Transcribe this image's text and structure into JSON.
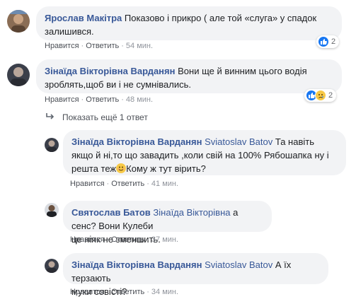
{
  "comments": [
    {
      "author": "Ярослав Макітра",
      "text": "Показово і прикро ( але той «слуга» у спадок залишився.",
      "like_label": "Нравится",
      "reply_label": "Ответить",
      "time": "54 мин.",
      "reactions_count": "2"
    },
    {
      "author": "Зінаїда Вікторівна Варданян",
      "text": "Вони ще й винним цього водія зроблять,щоб ви і не сумнівались.",
      "like_label": "Нравится",
      "reply_label": "Ответить",
      "time": "48 мин.",
      "reactions_count": "2"
    }
  ],
  "show_more_label": "Показать ещё 1 ответ",
  "replies": [
    {
      "author": "Зінаїда Вікторівна Варданян",
      "mention": "Sviatoslav Batov",
      "text_line1": "Та навіть",
      "text_line2": "якщо й ні,то що завадить ,коли свій на 100% Рябошапка ну і",
      "text_line3_a": "решта теж",
      "text_line3_b": "Кому ж тут вірить?",
      "like_label": "Нравится",
      "reply_label": "Ответить",
      "time": "41 мин."
    },
    {
      "author": "Святослав Батов",
      "mention": "Зінаїда Вікторівна",
      "text_line1": "а сенс? Вони Кулеби",
      "text_line2": "це ніяк не зменшить.",
      "like_label": "Нравится",
      "reply_label": "Ответить",
      "time": "37 мин."
    },
    {
      "author": "Зінаїда Вікторівна Варданян",
      "mention": "Sviatoslav Batov",
      "text_line1": "А їх терзають",
      "text_line2": "муки совісті?",
      "like_label": "Нравится",
      "reply_label": "Ответить",
      "time": "34 мин."
    }
  ],
  "colors": {
    "author_link": "#385898",
    "bubble_bg": "#f2f3f5",
    "like_blue": "#1877f2",
    "haha_yellow": "#f7c948"
  },
  "icons": {
    "like": "thumbs-up-icon",
    "sad": "sad-face-icon",
    "smile": "smiling-face-icon",
    "reply_arrow": "reply-arrow-icon"
  },
  "separator": "·"
}
